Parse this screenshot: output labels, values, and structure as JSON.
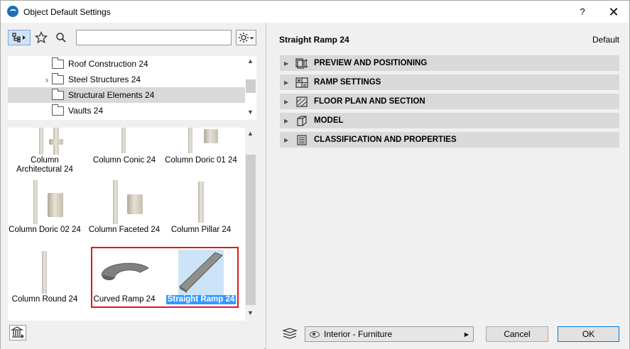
{
  "window": {
    "title": "Object Default Settings",
    "help_label": "?",
    "close_label": "✕"
  },
  "left": {
    "search": {
      "value": "",
      "placeholder": ""
    },
    "folders": [
      {
        "label": "Roof Construction 24",
        "expandable": false,
        "selected": false
      },
      {
        "label": "Steel Structures 24",
        "expandable": true,
        "selected": false
      },
      {
        "label": "Structural Elements 24",
        "expandable": false,
        "selected": true
      },
      {
        "label": "Vaults 24",
        "expandable": false,
        "selected": false
      }
    ],
    "objects": [
      {
        "label": "Column Architectural 24"
      },
      {
        "label": "Column Conic 24"
      },
      {
        "label": "Column Doric 01 24"
      },
      {
        "label": "Column Doric 02 24"
      },
      {
        "label": "Column Faceted 24"
      },
      {
        "label": "Column Pillar 24"
      },
      {
        "label": "Column Round 24"
      },
      {
        "label": "Curved Ramp 24"
      },
      {
        "label": "Straight Ramp 24",
        "selected": true
      }
    ]
  },
  "right": {
    "object_title": "Straight Ramp 24",
    "default_label": "Default",
    "sections": [
      {
        "label": "PREVIEW AND POSITIONING",
        "icon": "preview-icon"
      },
      {
        "label": "RAMP SETTINGS",
        "icon": "settings-icon"
      },
      {
        "label": "FLOOR PLAN AND SECTION",
        "icon": "floor-plan-icon"
      },
      {
        "label": "MODEL",
        "icon": "model-cube-icon"
      },
      {
        "label": "CLASSIFICATION AND PROPERTIES",
        "icon": "classification-icon"
      }
    ],
    "layer_value": "Interior - Furniture",
    "cancel_label": "Cancel",
    "ok_label": "OK"
  },
  "colors": {
    "selection": "#3399ff",
    "highlight_border": "#e0151b",
    "section_bg": "#d9d9d9"
  }
}
